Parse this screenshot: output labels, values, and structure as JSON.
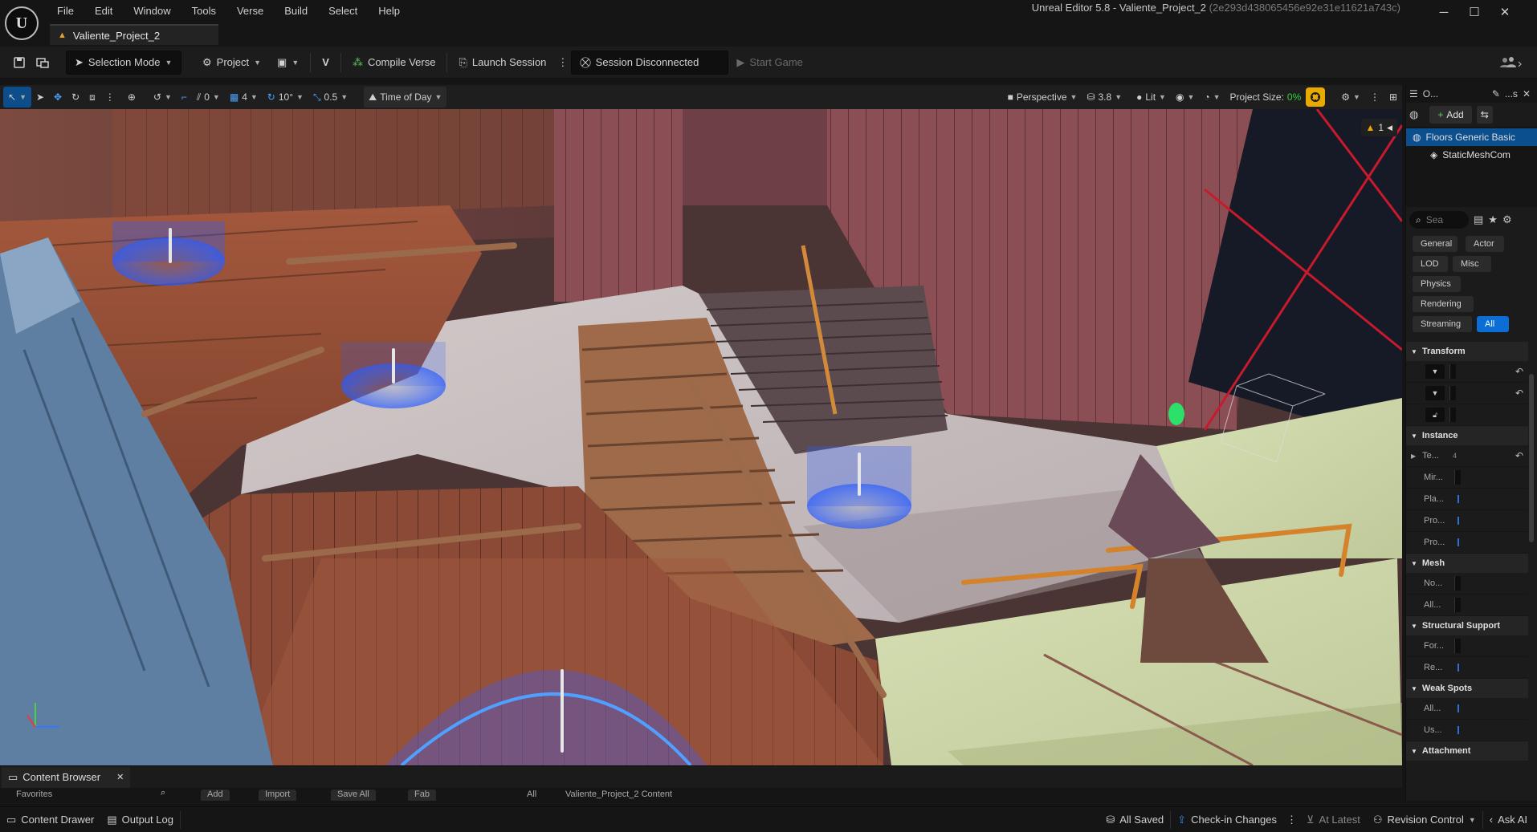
{
  "window": {
    "app_title": "Unreal Editor 5.8 - Valiente_Project_2",
    "hash": "(2e293d438065456e92e31e11621a743c)",
    "project_tab": "Valiente_Project_2",
    "logo_text": "U"
  },
  "menu": [
    "File",
    "Edit",
    "Window",
    "Tools",
    "Verse",
    "Build",
    "Select",
    "Help"
  ],
  "toolbar": {
    "selection_mode": "Selection Mode",
    "project": "Project",
    "compile_verse": "Compile Verse",
    "launch_session": "Launch Session",
    "session_status": "Session Disconnected",
    "start_game": "Start Game"
  },
  "viewport_toolbar": {
    "snap_translate": "0",
    "snap_grid": "4",
    "snap_rotate": "10°",
    "snap_scale": "0.5",
    "time_of_day": "Time of Day",
    "perspective": "Perspective",
    "camera_speed": "3.8",
    "view_mode": "Lit",
    "project_size_label": "Project Size:",
    "project_size_value": "0%",
    "warning_count": "1"
  },
  "outliner": {
    "tab1": "O...",
    "tab2": "...s",
    "add_label": "Add",
    "items": [
      {
        "label": "Floors Generic Basic",
        "selected": true
      },
      {
        "label": "StaticMeshCom",
        "selected": false
      }
    ]
  },
  "details": {
    "search_placeholder": "Sea",
    "filters": [
      "General",
      "Actor",
      "LOD",
      "Misc",
      "Physics",
      "Rendering",
      "Streaming",
      "All"
    ],
    "sections": {
      "transform": "Transform",
      "instance": "Instance",
      "mesh": "Mesh",
      "structural": "Structural Support",
      "weak_spots": "Weak Spots",
      "attachment": "Attachment"
    },
    "instance_rows": [
      "Te...",
      "Mir...",
      "Pla...",
      "Pro...",
      "Pro..."
    ],
    "instance_te_value": "4",
    "mesh_rows": [
      "No...",
      "All..."
    ],
    "structural_rows": [
      "For...",
      "Re..."
    ],
    "weak_rows": [
      "All...",
      "Us..."
    ]
  },
  "content_browser": {
    "tab": "Content Browser",
    "add": "Add",
    "import": "Import",
    "save_all": "Save All",
    "fab": "Fab",
    "path_all": "All",
    "path_content": "Valiente_Project_2 Content",
    "favorites": "Favorites"
  },
  "statusbar": {
    "content_drawer": "Content Drawer",
    "output_log": "Output Log",
    "all_saved": "All Saved",
    "check_in": "Check-in Changes",
    "at_latest": "At Latest",
    "revision_control": "Revision Control",
    "ask_ai": "Ask AI"
  },
  "colors": {
    "accent_blue": "#0b6dd6",
    "selection_blue": "#0b4f8f",
    "warning_yellow": "#e8a900",
    "project_size_green": "#32d13a"
  }
}
